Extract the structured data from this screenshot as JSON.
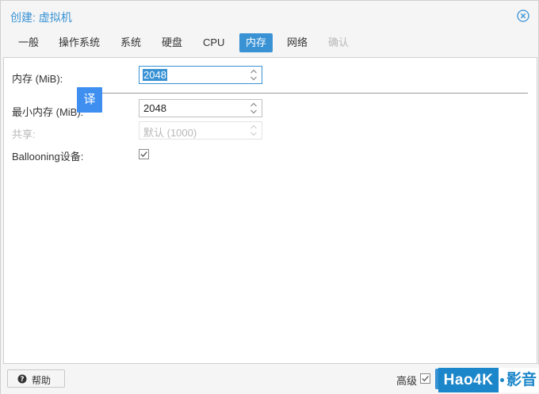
{
  "dialog": {
    "title": "创建: 虚拟机"
  },
  "tabs": [
    {
      "label": "一般",
      "state": "normal"
    },
    {
      "label": "操作系统",
      "state": "normal"
    },
    {
      "label": "系统",
      "state": "normal"
    },
    {
      "label": "硬盘",
      "state": "normal"
    },
    {
      "label": "CPU",
      "state": "normal"
    },
    {
      "label": "内存",
      "state": "active"
    },
    {
      "label": "网络",
      "state": "normal"
    },
    {
      "label": "确认",
      "state": "disabled"
    }
  ],
  "memory": {
    "label": "内存 (MiB):",
    "value": "2048"
  },
  "min_memory": {
    "label": "最小内存 (MiB):",
    "value": "2048"
  },
  "shares": {
    "label": "共享:",
    "placeholder": "默认 (1000)"
  },
  "ballooning": {
    "label": "Ballooning设备:",
    "checked": true
  },
  "translate_badge": {
    "label": "译"
  },
  "footer": {
    "help_label": "帮助",
    "advanced_label": "高级",
    "advanced_checked": true
  },
  "watermark": {
    "left": "Hao4K",
    "right": "影音"
  },
  "colors": {
    "accent": "#3892d4",
    "disabled_text": "#b8b8b8",
    "watermark_blue": "#1b86c9"
  }
}
